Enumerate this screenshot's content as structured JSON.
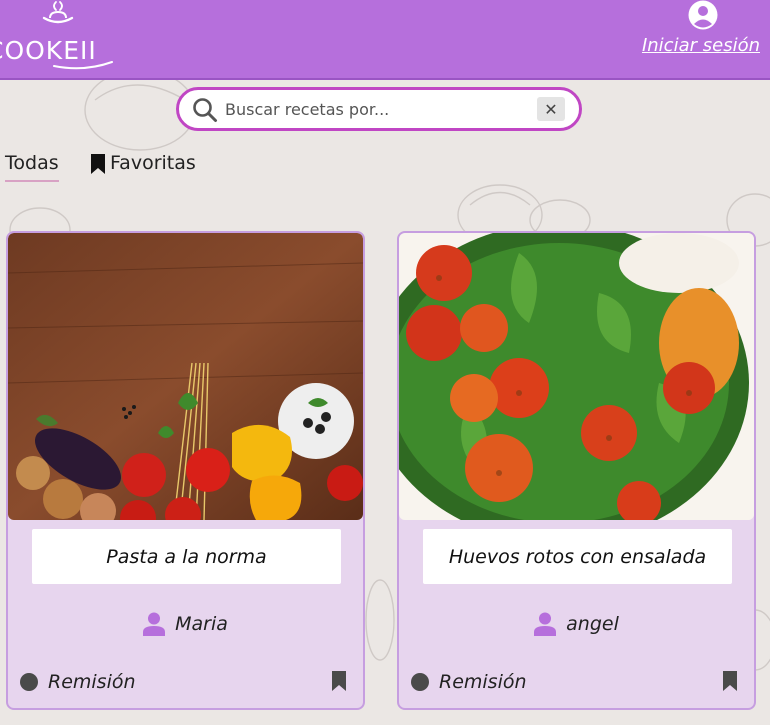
{
  "header": {
    "logo_text": "COOKEII",
    "login_link": "Iniciar sesión"
  },
  "search": {
    "placeholder": "Buscar recetas por...",
    "clear_label": "✕"
  },
  "tabs": [
    {
      "label": "Todas",
      "active": true
    },
    {
      "label": "Favoritas",
      "active": false
    }
  ],
  "recipes": [
    {
      "title": "Pasta a la norma",
      "author": "Maria",
      "status": "Remisión"
    },
    {
      "title": "Huevos rotos con ensalada",
      "author": "angel",
      "status": "Remisión"
    }
  ],
  "colors": {
    "header": "#b66fdc",
    "accent": "#c046c4",
    "card_bg": "#e7d5ee",
    "page_bg": "#ebe7e4"
  }
}
